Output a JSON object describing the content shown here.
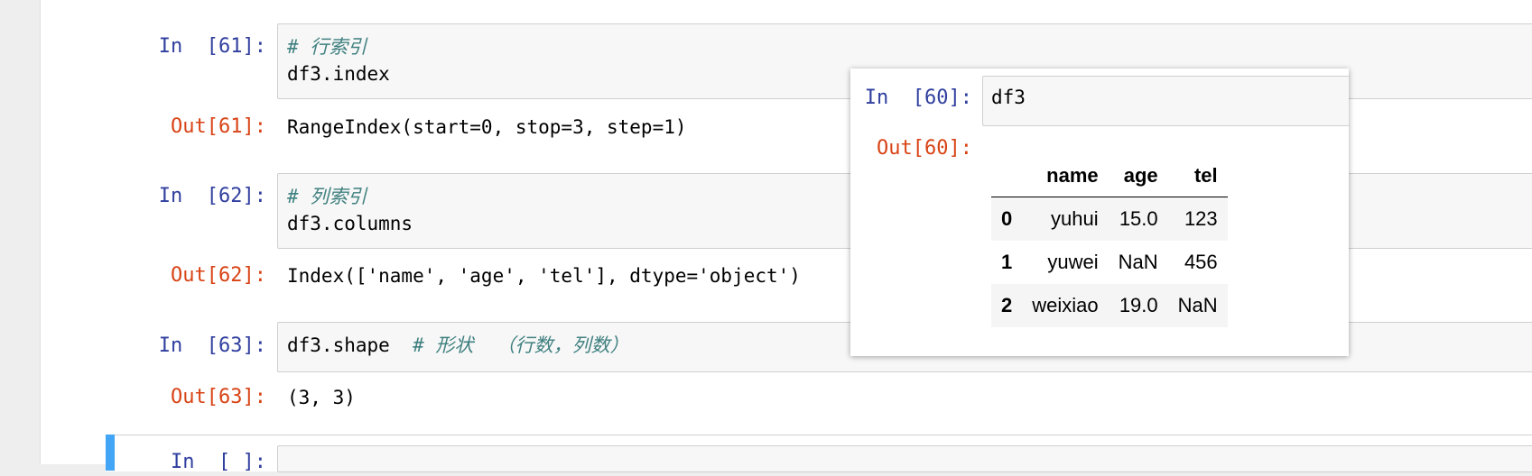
{
  "cells": [
    {
      "in_prompt": "In  [61]:",
      "code": [
        {
          "type": "comment",
          "text": "# 行索引"
        },
        {
          "type": "code",
          "text": "df3.index"
        }
      ],
      "out_prompt": "Out[61]:",
      "output": "RangeIndex(start=0, stop=3, step=1)"
    },
    {
      "in_prompt": "In  [62]:",
      "code": [
        {
          "type": "comment",
          "text": "# 列索引"
        },
        {
          "type": "code",
          "text": "df3.columns"
        }
      ],
      "out_prompt": "Out[62]:",
      "output": "Index(['name', 'age', 'tel'], dtype='object')"
    },
    {
      "in_prompt": "In  [63]:",
      "code_main": "df3.shape  ",
      "code_comment": "# 形状  （行数，列数）",
      "out_prompt": "Out[63]:",
      "output": "(3, 3)"
    },
    {
      "in_prompt": "In  [ ]:"
    }
  ],
  "popup": {
    "in_prompt": "In  [60]:",
    "code": "df3",
    "out_prompt": "Out[60]:",
    "table": {
      "columns": [
        "",
        "name",
        "age",
        "tel"
      ],
      "rows": [
        [
          "0",
          "yuhui",
          "15.0",
          "123"
        ],
        [
          "1",
          "yuwei",
          "NaN",
          "456"
        ],
        [
          "2",
          "weixiao",
          "19.0",
          "NaN"
        ]
      ]
    }
  },
  "colors": {
    "in_prompt": "#303F9F",
    "out_prompt": "#D84315",
    "comment": "#408080",
    "selected_bar": "#42A5F5"
  }
}
